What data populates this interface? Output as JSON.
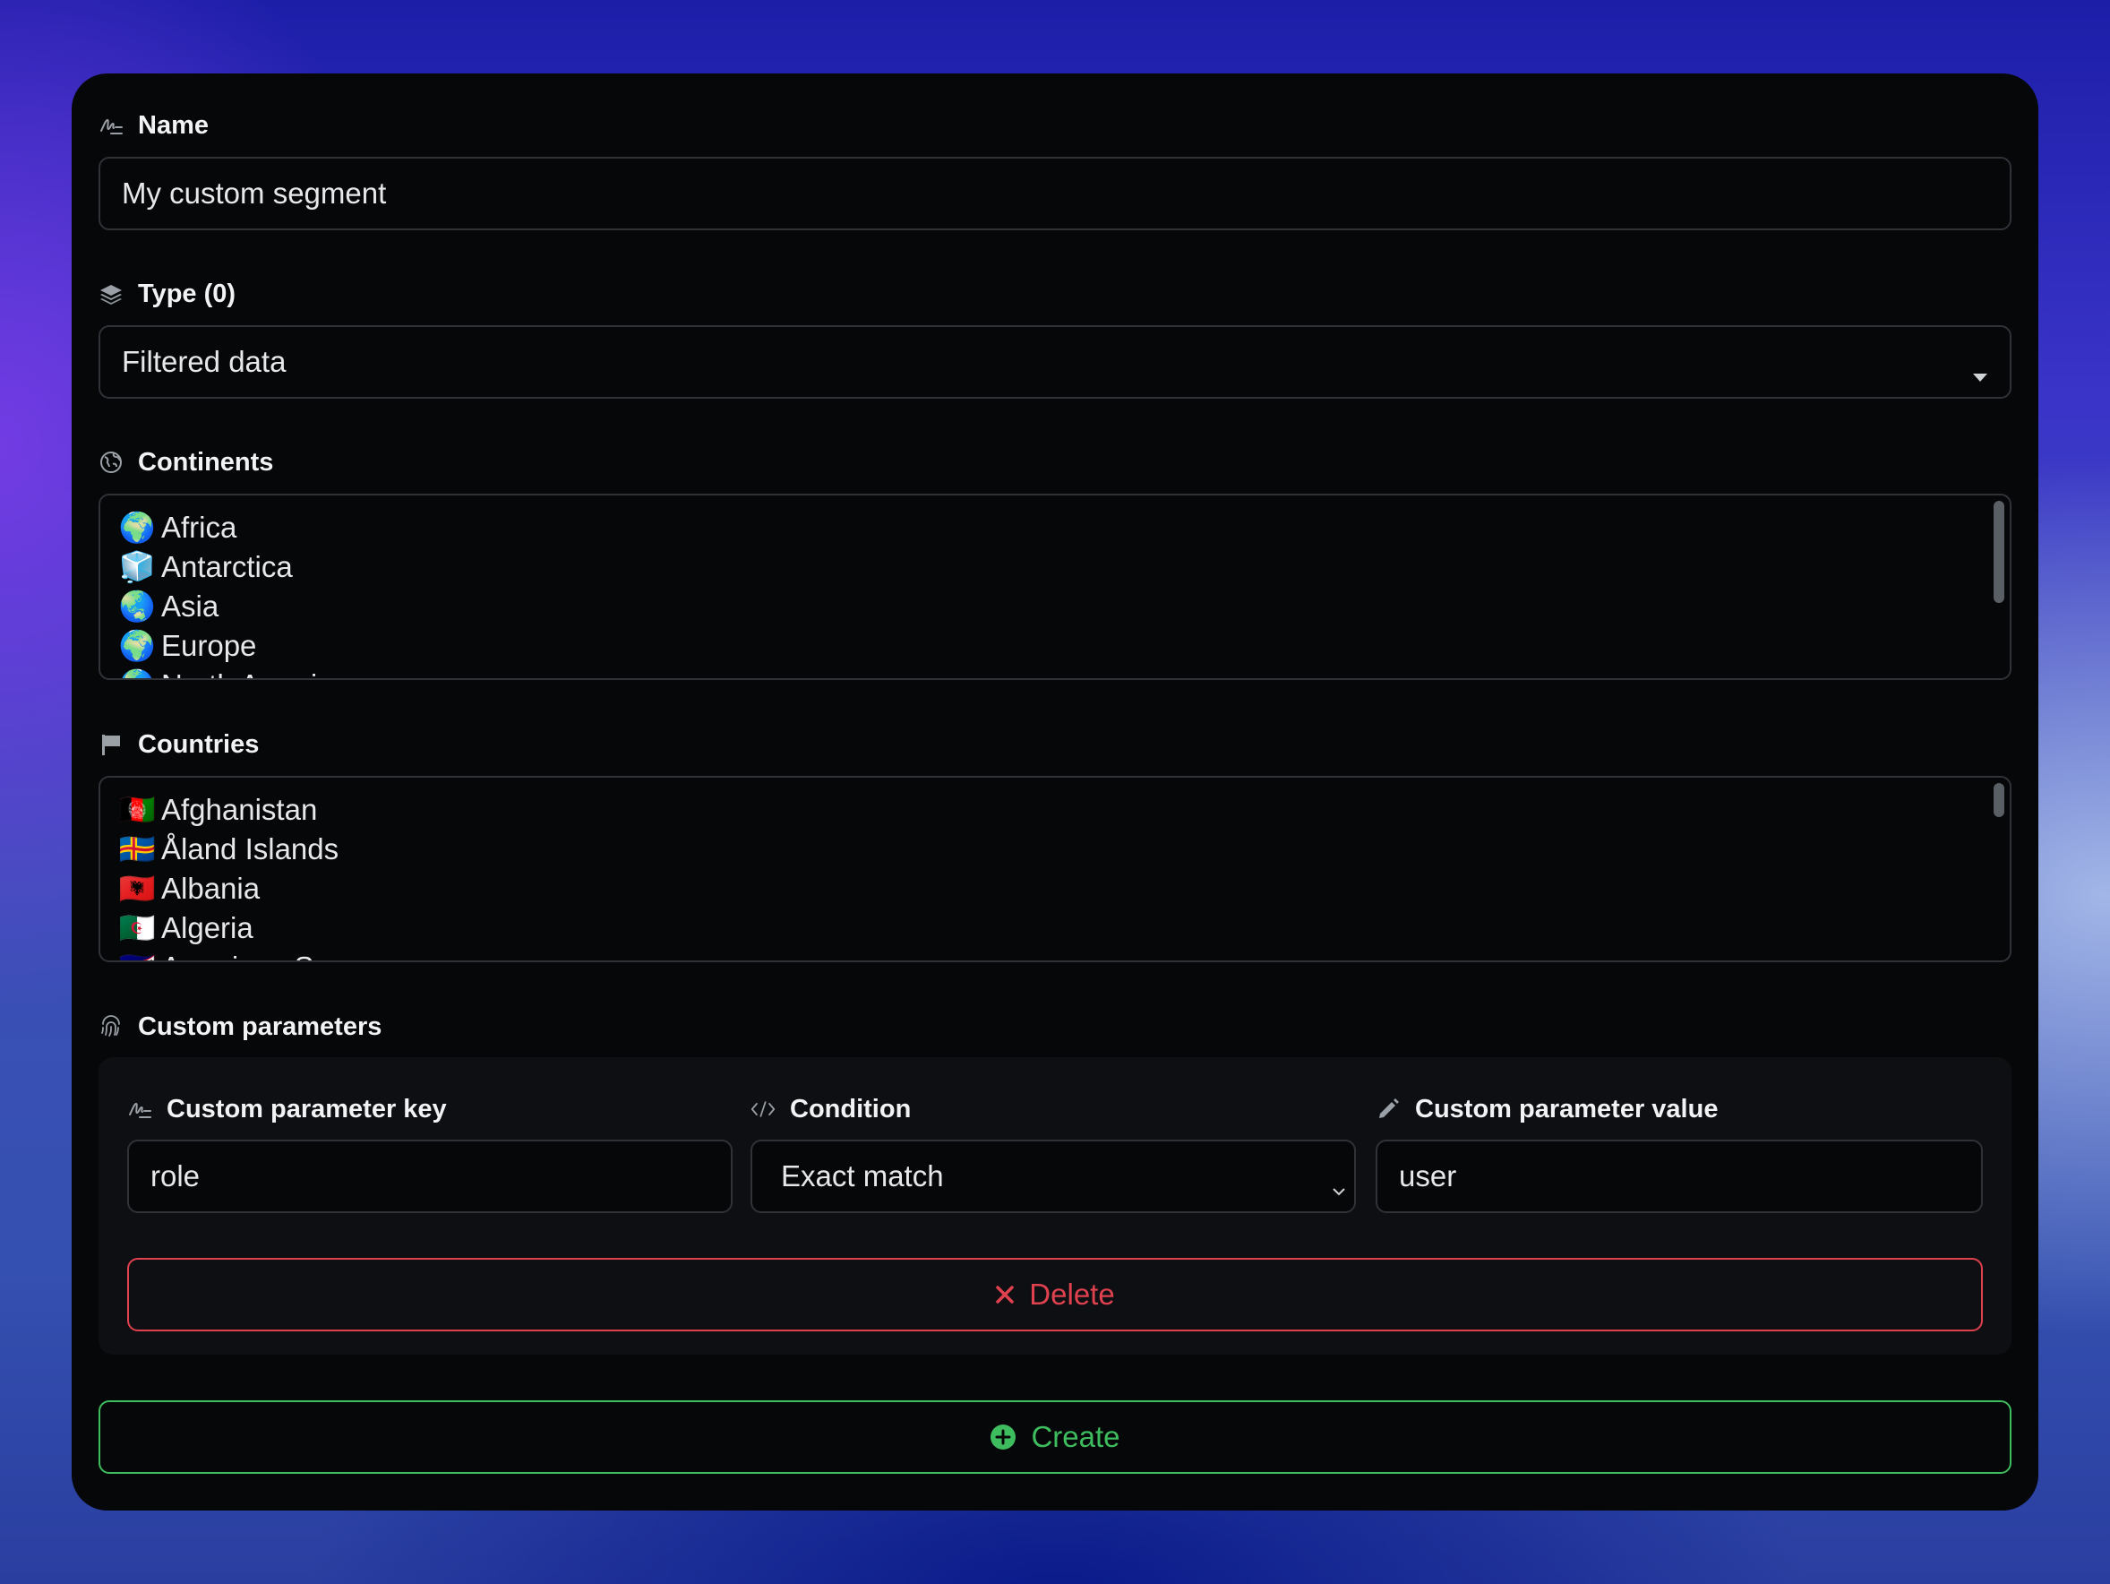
{
  "form": {
    "name": {
      "label": "Name",
      "icon": "signature-icon",
      "value": "My custom segment"
    },
    "type": {
      "label": "Type (0)",
      "icon": "layers-icon",
      "selected": "Filtered data"
    },
    "continents": {
      "label": "Continents",
      "icon": "globe-icon",
      "options": [
        {
          "emoji": "🌍",
          "label": "Africa"
        },
        {
          "emoji": "🧊",
          "label": "Antarctica"
        },
        {
          "emoji": "🌏",
          "label": "Asia"
        },
        {
          "emoji": "🌍",
          "label": "Europe"
        },
        {
          "emoji": "🌎",
          "label": "North America"
        }
      ]
    },
    "countries": {
      "label": "Countries",
      "icon": "flag-icon",
      "options": [
        {
          "emoji": "🇦🇫",
          "label": "Afghanistan"
        },
        {
          "emoji": "🇦🇽",
          "label": "Åland Islands"
        },
        {
          "emoji": "🇦🇱",
          "label": "Albania"
        },
        {
          "emoji": "🇩🇿",
          "label": "Algeria"
        },
        {
          "emoji": "🇦🇸",
          "label": "American Samoa"
        }
      ]
    },
    "custom_parameters": {
      "label": "Custom parameters",
      "icon": "fingerprint-icon",
      "key": {
        "label": "Custom parameter key",
        "icon": "signature-icon",
        "value": "role"
      },
      "condition": {
        "label": "Condition",
        "icon": "code-icon",
        "selected": "Exact match"
      },
      "value": {
        "label": "Custom parameter value",
        "icon": "pencil-icon",
        "value": "user"
      },
      "delete_label": "Delete"
    },
    "create_label": "Create"
  },
  "colors": {
    "danger": "#e0414f",
    "success": "#3ebd5e",
    "border": "#2f3338"
  }
}
